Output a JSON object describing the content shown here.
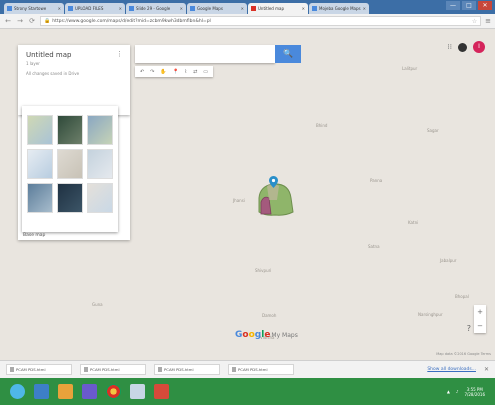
{
  "browser": {
    "tabs": [
      {
        "label": "Strony Startowe"
      },
      {
        "label": "UPLOAD FILES"
      },
      {
        "label": "Slide 29 - Google"
      },
      {
        "label": "Google Maps"
      },
      {
        "label": "Untitled map"
      },
      {
        "label": "Mojeba Google Maps"
      }
    ],
    "url": "https://www.google.com/maps/d/edit?mid=zcbm9kwh3dbmflbn&hl=pl",
    "window_buttons": [
      "—",
      "□",
      "✕"
    ]
  },
  "panel": {
    "title": "Untitled map",
    "subtitle": "1 layer",
    "info": "All changes saved in Drive",
    "base_map_label": "Base map"
  },
  "search": {
    "placeholder": "",
    "button": "🔍"
  },
  "tools": [
    "↶",
    "↷",
    "✋",
    "📍",
    "⌇",
    "⇄",
    "▭"
  ],
  "map_labels": [
    {
      "text": "Lalitpur"
    },
    {
      "text": "Sagar"
    },
    {
      "text": "Bhind"
    },
    {
      "text": "Jhansi"
    },
    {
      "text": "Panna"
    },
    {
      "text": "Shivpuri"
    },
    {
      "text": "Katni"
    },
    {
      "text": "Satna"
    },
    {
      "text": "Jabalpur"
    },
    {
      "text": "Bhopal"
    },
    {
      "text": "Guna"
    },
    {
      "text": "Damoh"
    },
    {
      "text": "Narsinghpur"
    },
    {
      "text": "Vidisha"
    }
  ],
  "logo": {
    "g": "G",
    "o1": "o",
    "o2": "o",
    "g2": "g",
    "l": "l",
    "e": "e",
    "suffix": "My Maps"
  },
  "map_data_text": "Map data ©2016 Google  Terms",
  "zoom": {
    "plus": "+",
    "minus": "−"
  },
  "downloads": {
    "items": [
      "PCAM PDS.html",
      "PCAM PDS.html",
      "PCAM PDS.html",
      "PCAM PDS.html"
    ],
    "show_all": "Show all downloads..."
  },
  "taskbar": {
    "time": "3:55 PM",
    "date": "7/28/2016"
  }
}
